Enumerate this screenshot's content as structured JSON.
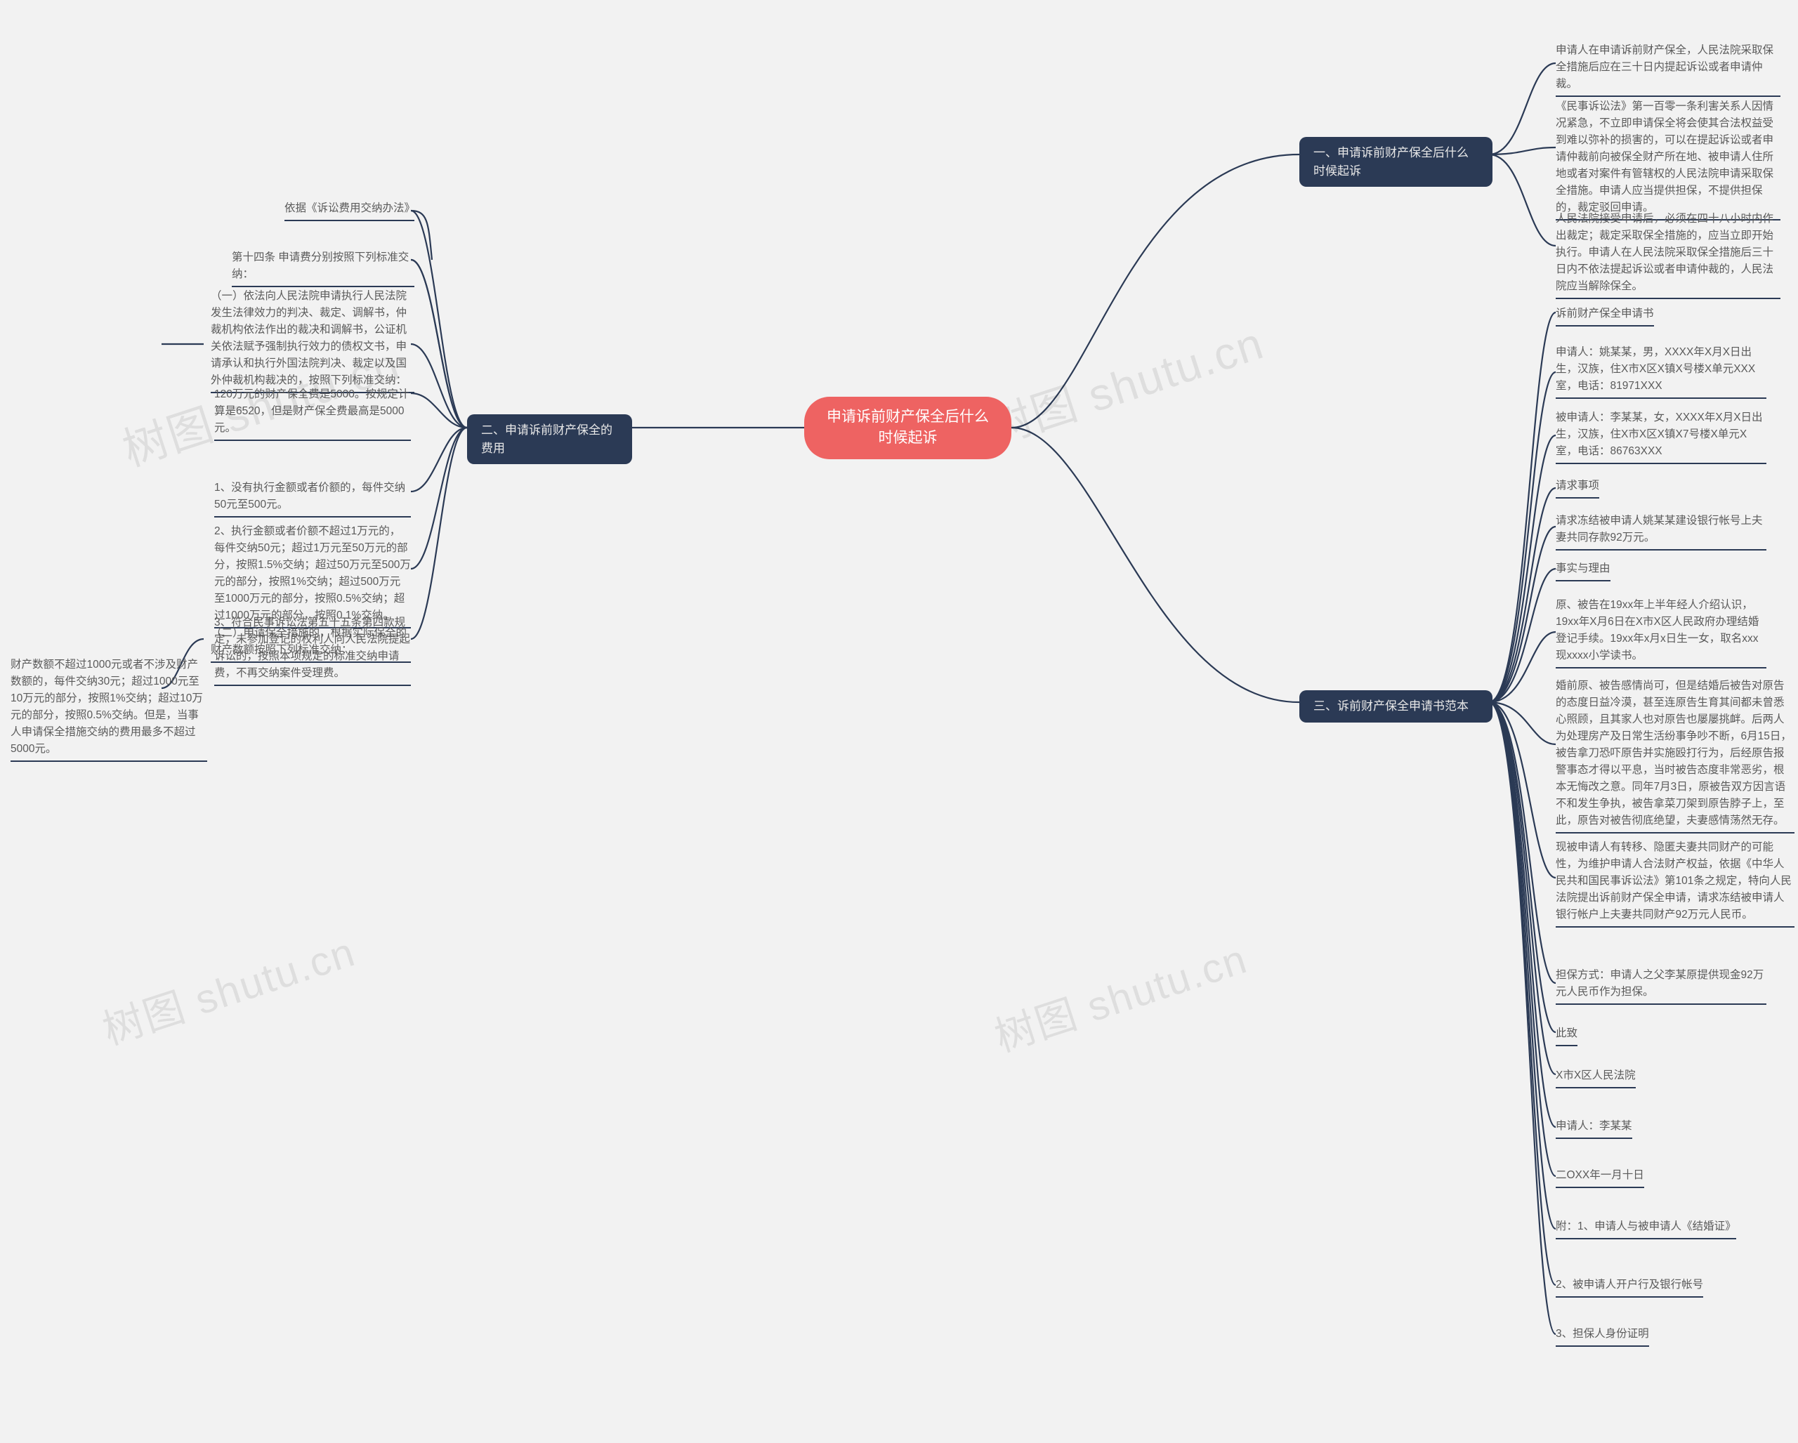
{
  "watermark": "树图 shutu.cn",
  "root": "申请诉前财产保全后什么时候起诉",
  "branches": {
    "b1": {
      "title": "一、申请诉前财产保全后什么时候起诉",
      "leaves": [
        "申请人在申请诉前财产保全，人民法院采取保全措施后应在三十日内提起诉讼或者申请仲裁。",
        "《民事诉讼法》第一百零一条利害关系人因情况紧急，不立即申请保全将会使其合法权益受到难以弥补的损害的，可以在提起诉讼或者申请仲裁前向被保全财产所在地、被申请人住所地或者对案件有管辖权的人民法院申请采取保全措施。申请人应当提供担保，不提供担保的，裁定驳回申请。",
        "人民法院接受申请后，必须在四十八小时内作出裁定；裁定采取保全措施的，应当立即开始执行。申请人在人民法院采取保全措施后三十日内不依法提起诉讼或者申请仲裁的，人民法院应当解除保全。"
      ]
    },
    "b2": {
      "title": "二、申请诉前财产保全的费用",
      "left1": "依据《诉讼费用交纳办法》",
      "left2": "第十四条 申请费分别按照下列标准交纳：",
      "left3": "（一）依法向人民法院申请执行人民法院发生法律效力的判决、裁定、调解书，仲裁机构依法作出的裁决和调解书，公证机关依法赋予强制执行效力的债权文书，申请承认和执行外国法院判决、裁定以及国外仲裁机构裁决的，按照下列标准交纳：",
      "right1": "120万元的财产保全费是5000。按规定计算是6520，但是财产保全费最高是5000元。",
      "right2": "1、没有执行金额或者价额的，每件交纳50元至500元。",
      "right3": "2、执行金额或者价额不超过1万元的，每件交纳50元；超过1万元至50万元的部分，按照1.5%交纳；超过50万元至500万元的部分，按照1%交纳；超过500万元至1000万元的部分，按照0.5%交纳；超过1000万元的部分，按照0.1%交纳。",
      "right4": "3、符合民事诉讼法第五十五条第四款规定，未参加登记的权利人向人民法院提起诉讼的，按照本项规定的标准交纳申请费，不再交纳案件受理费。",
      "left4": "（二）申请保全措施的，根据实际保全的财产数额按照下列标准交纳：",
      "left5": "财产数额不超过1000元或者不涉及财产数额的，每件交纳30元；超过1000元至10万元的部分，按照1%交纳；超过10万元的部分，按照0.5%交纳。但是，当事人申请保全措施交纳的费用最多不超过5000元。"
    },
    "b3": {
      "title": "三、诉前财产保全申请书范本",
      "leaves": [
        "诉前财产保全申请书",
        "申请人：姚某某，男，XXXX年X月X日出生，汉族，住X市X区X镇X号楼X单元XXX室，电话：81971XXX",
        "被申请人：李某某，女，XXXX年X月X日出生，汉族，住X市X区X镇X7号楼X单元X室，电话：86763XXX",
        "请求事项",
        "请求冻结被申请人姚某某建设银行帐号上夫妻共同存款92万元。",
        "事实与理由",
        "原、被告在19xx年上半年经人介绍认识，19xx年X月6日在X市X区人民政府办理结婚登记手续。19xx年x月x日生一女，取名xxx现xxxx小学读书。",
        "婚前原、被告感情尚可，但是结婚后被告对原告的态度日益冷漠，甚至连原告生育其间都未曾悉心照顾，且其家人也对原告也屡屡挑衅。后两人为处理房产及日常生活纷事争吵不断，6月15日，被告拿刀恐吓原告并实施殴打行为，后经原告报警事态才得以平息，当时被告态度非常恶劣，根本无悔改之意。同年7月3日，原被告双方因言语不和发生争执，被告拿菜刀架到原告脖子上，至此，原告对被告彻底绝望，夫妻感情荡然无存。",
        "现被申请人有转移、隐匿夫妻共同财产的可能性，为维护申请人合法财产权益，依据《中华人民共和国民事诉讼法》第101条之规定，特向人民法院提出诉前财产保全申请，请求冻结被申请人银行帐户上夫妻共同财产92万元人民币。",
        "担保方式：申请人之父李某原提供现金92万元人民币作为担保。",
        "此致",
        "X市X区人民法院",
        "申请人：李某某",
        "二OXX年一月十日",
        "附：1、申请人与被申请人《结婚证》",
        "2、被申请人开户行及银行帐号",
        "3、担保人身份证明"
      ]
    }
  },
  "chart_data": {
    "type": "mindmap",
    "root": "申请诉前财产保全后什么时候起诉",
    "children": [
      {
        "label": "一、申请诉前财产保全后什么时候起诉",
        "side": "right",
        "children": [
          {
            "label": "申请人在申请诉前财产保全，人民法院采取保全措施后应在三十日内提起诉讼或者申请仲裁。"
          },
          {
            "label": "《民事诉讼法》第一百零一条利害关系人因情况紧急，不立即申请保全将会使其合法权益受到难以弥补的损害的，可以在提起诉讼或者申请仲裁前向被保全财产所在地、被申请人住所地或者对案件有管辖权的人民法院申请采取保全措施。申请人应当提供担保，不提供担保的，裁定驳回申请。"
          },
          {
            "label": "人民法院接受申请后，必须在四十八小时内作出裁定；裁定采取保全措施的，应当立即开始执行。申请人在人民法院采取保全措施后三十日内不依法提起诉讼或者申请仲裁的，人民法院应当解除保全。"
          }
        ]
      },
      {
        "label": "二、申请诉前财产保全的费用",
        "side": "left",
        "children": [
          {
            "label": "依据《诉讼费用交纳办法》"
          },
          {
            "label": "第十四条 申请费分别按照下列标准交纳："
          },
          {
            "label": "120万元的财产保全费是5000。按规定计算是6520，但是财产保全费最高是5000元。"
          },
          {
            "label": "（一）依法向人民法院申请执行人民法院发生法律效力的判决、裁定、调解书，仲裁机构依法作出的裁决和调解书，公证机关依法赋予强制执行效力的债权文书，申请承认和执行外国法院判决、裁定以及国外仲裁机构裁决的，按照下列标准交纳："
          },
          {
            "label": "1、没有执行金额或者价额的，每件交纳50元至500元。"
          },
          {
            "label": "2、执行金额或者价额不超过1万元的，每件交纳50元；超过1万元至50万元的部分，按照1.5%交纳；超过50万元至500万元的部分，按照1%交纳；超过500万元至1000万元的部分，按照0.5%交纳；超过1000万元的部分，按照0.1%交纳。"
          },
          {
            "label": "3、符合民事诉讼法第五十五条第四款规定，未参加登记的权利人向人民法院提起诉讼的，按照本项规定的标准交纳申请费，不再交纳案件受理费。"
          },
          {
            "label": "（二）申请保全措施的，根据实际保全的财产数额按照下列标准交纳：",
            "children": [
              {
                "label": "财产数额不超过1000元或者不涉及财产数额的，每件交纳30元；超过1000元至10万元的部分，按照1%交纳；超过10万元的部分，按照0.5%交纳。但是，当事人申请保全措施交纳的费用最多不超过5000元。"
              }
            ]
          }
        ]
      },
      {
        "label": "三、诉前财产保全申请书范本",
        "side": "right",
        "children": [
          {
            "label": "诉前财产保全申请书"
          },
          {
            "label": "申请人：姚某某，男，XXXX年X月X日出生，汉族，住X市X区X镇X号楼X单元XXX室，电话：81971XXX"
          },
          {
            "label": "被申请人：李某某，女，XXXX年X月X日出生，汉族，住X市X区X镇X7号楼X单元X室，电话：86763XXX"
          },
          {
            "label": "请求事项"
          },
          {
            "label": "请求冻结被申请人姚某某建设银行帐号上夫妻共同存款92万元。"
          },
          {
            "label": "事实与理由"
          },
          {
            "label": "原、被告在19xx年上半年经人介绍认识，19xx年X月6日在X市X区人民政府办理结婚登记手续。19xx年x月x日生一女，取名xxx现xxxx小学读书。"
          },
          {
            "label": "婚前原、被告感情尚可，但是结婚后被告对原告的态度日益冷漠，甚至连原告生育其间都未曾悉心照顾，且其家人也对原告也屡屡挑衅。后两人为处理房产及日常生活纷事争吵不断，6月15日，被告拿刀恐吓原告并实施殴打行为，后经原告报警事态才得以平息，当时被告态度非常恶劣，根本无悔改之意。同年7月3日，原被告双方因言语不和发生争执，被告拿菜刀架到原告脖子上，至此，原告对被告彻底绝望，夫妻感情荡然无存。"
          },
          {
            "label": "现被申请人有转移、隐匿夫妻共同财产的可能性，为维护申请人合法财产权益，依据《中华人民共和国民事诉讼法》第101条之规定，特向人民法院提出诉前财产保全申请，请求冻结被申请人银行帐户上夫妻共同财产92万元人民币。"
          },
          {
            "label": "担保方式：申请人之父李某原提供现金92万元人民币作为担保。"
          },
          {
            "label": "此致"
          },
          {
            "label": "X市X区人民法院"
          },
          {
            "label": "申请人：李某某"
          },
          {
            "label": "二OXX年一月十日"
          },
          {
            "label": "附：1、申请人与被申请人《结婚证》"
          },
          {
            "label": "2、被申请人开户行及银行帐号"
          },
          {
            "label": "3、担保人身份证明"
          }
        ]
      }
    ]
  }
}
